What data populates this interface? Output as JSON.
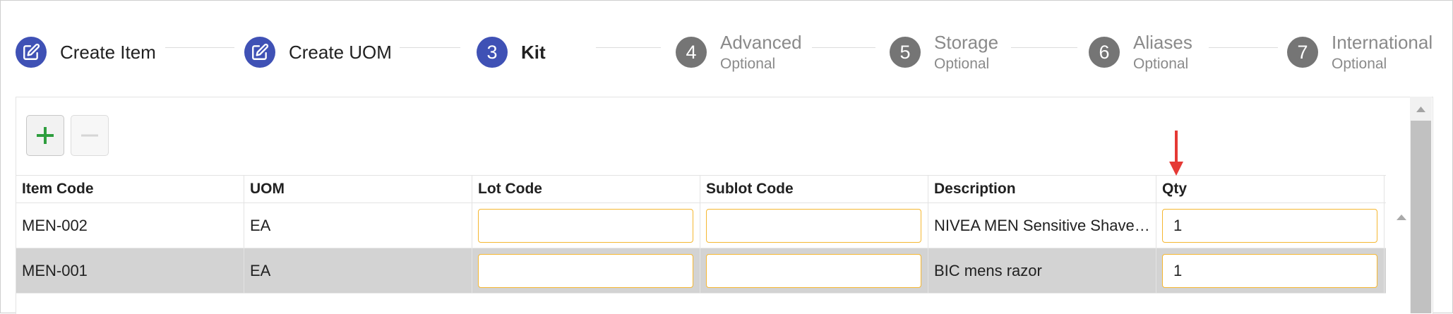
{
  "stepper": {
    "steps": [
      {
        "number": "",
        "label": "Create Item",
        "sublabel": "",
        "state": "completed"
      },
      {
        "number": "",
        "label": "Create UOM",
        "sublabel": "",
        "state": "completed"
      },
      {
        "number": "3",
        "label": "Kit",
        "sublabel": "",
        "state": "active"
      },
      {
        "number": "4",
        "label": "Advanced",
        "sublabel": "Optional",
        "state": "pending"
      },
      {
        "number": "5",
        "label": "Storage",
        "sublabel": "Optional",
        "state": "pending"
      },
      {
        "number": "6",
        "label": "Aliases",
        "sublabel": "Optional",
        "state": "pending"
      },
      {
        "number": "7",
        "label": "International",
        "sublabel": "Optional",
        "state": "pending"
      }
    ]
  },
  "toolbar": {
    "add_icon": "plus-icon",
    "remove_icon": "minus-icon"
  },
  "grid": {
    "columns": [
      "Item Code",
      "UOM",
      "Lot Code",
      "Sublot Code",
      "Description",
      "Qty"
    ],
    "rows": [
      {
        "item_code": "MEN-002",
        "uom": "EA",
        "lot_code": "",
        "sublot_code": "",
        "description": "NIVEA MEN Sensitive Shave Gel",
        "qty": "1",
        "selected": false
      },
      {
        "item_code": "MEN-001",
        "uom": "EA",
        "lot_code": "",
        "sublot_code": "",
        "description": "BIC mens razor",
        "qty": "1",
        "selected": true
      }
    ]
  },
  "colors": {
    "step_active": "#3f51b5",
    "step_pending": "#757575",
    "input_border": "#f5b731",
    "annotation_arrow": "#e53935",
    "add_icon": "#2e9e3e"
  }
}
